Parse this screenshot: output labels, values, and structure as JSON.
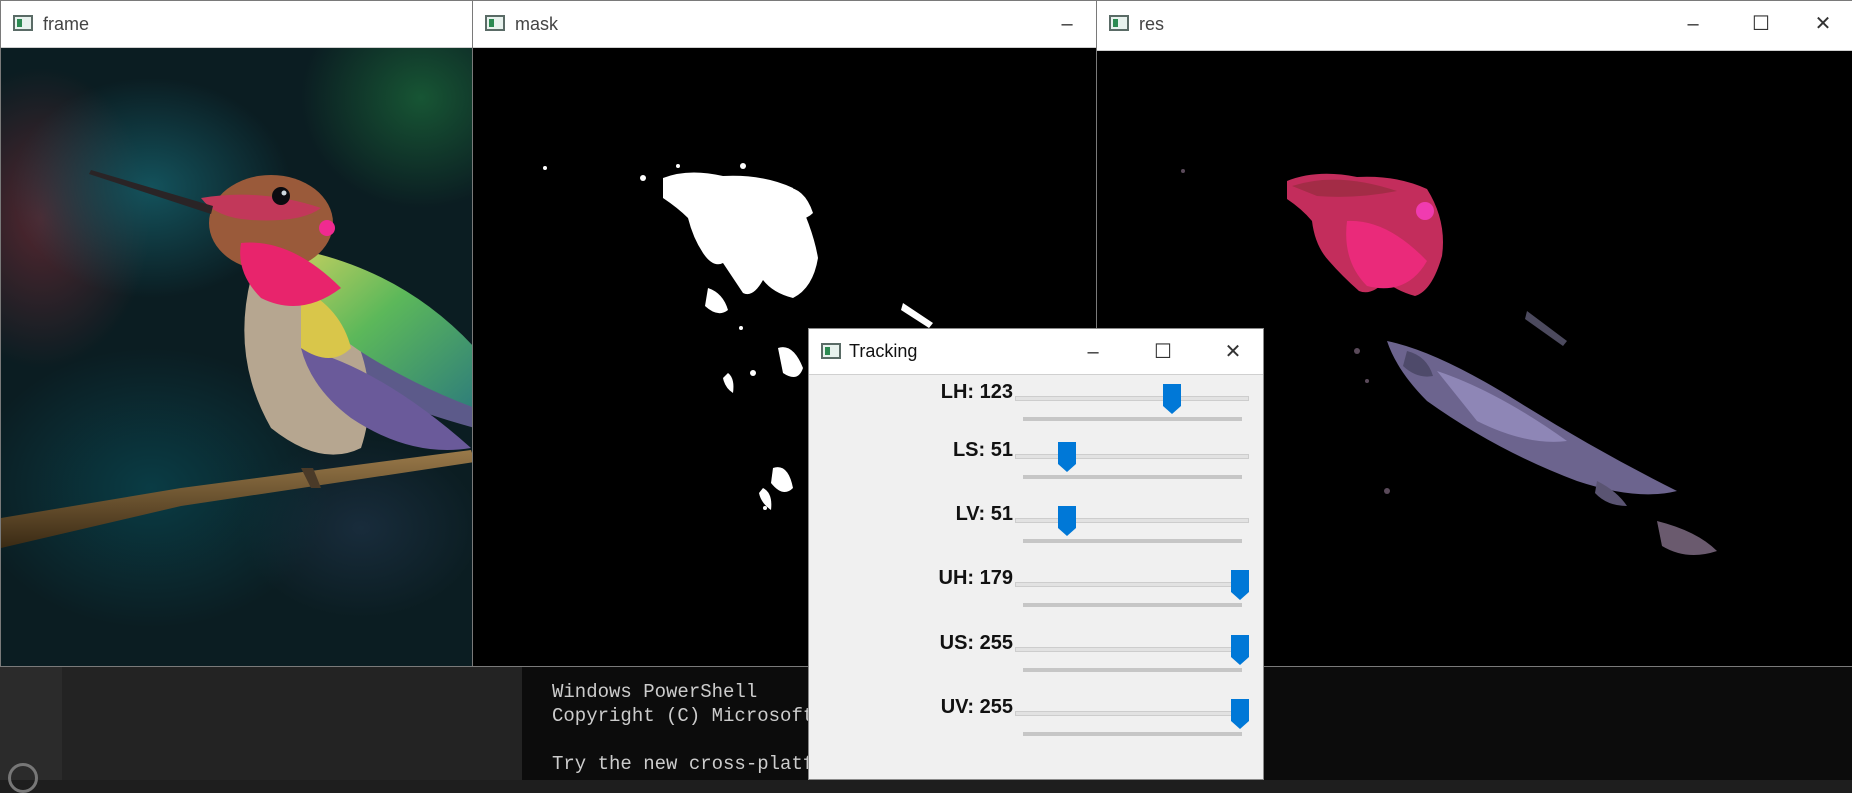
{
  "windows": {
    "frame": {
      "title": "frame"
    },
    "mask": {
      "title": "mask"
    },
    "res": {
      "title": "res"
    }
  },
  "tracking": {
    "title": "Tracking",
    "sliders": [
      {
        "label": "LH: 123",
        "value": 123,
        "max": 179
      },
      {
        "label": "LS: 51",
        "value": 51,
        "max": 255
      },
      {
        "label": "LV: 51",
        "value": 51,
        "max": 255
      },
      {
        "label": "UH: 179",
        "value": 179,
        "max": 179
      },
      {
        "label": "US: 255",
        "value": 255,
        "max": 255
      },
      {
        "label": "UV: 255",
        "value": 255,
        "max": 255
      }
    ]
  },
  "powershell": {
    "lines": [
      "Windows PowerShell",
      "Copyright (C) Microsoft",
      "",
      "Try the new cross-platfo"
    ]
  },
  "colors": {
    "accent": "#0078d7",
    "mask_white": "#ffffff",
    "magenta": "#e8246c"
  }
}
